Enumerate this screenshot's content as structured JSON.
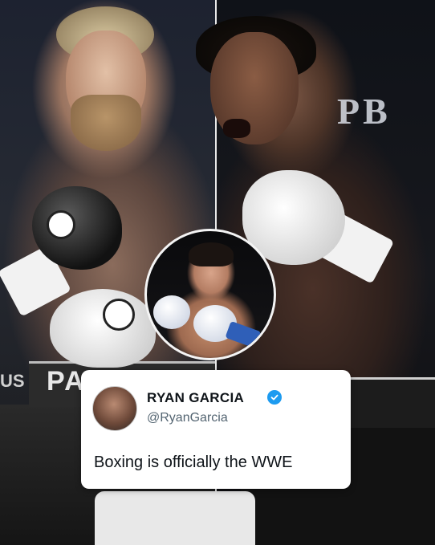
{
  "background": {
    "left_trunks_text": "PA",
    "left_banner_text": "US",
    "right_arena_sign": "PB"
  },
  "tweet": {
    "display_name": "RYAN GARCIA",
    "handle": "@RyanGarcia",
    "text": "Boxing is officially the WWE",
    "verified": true,
    "verified_color": "#1d9bf0"
  },
  "icons": {
    "verified": "verified-badge-icon"
  }
}
